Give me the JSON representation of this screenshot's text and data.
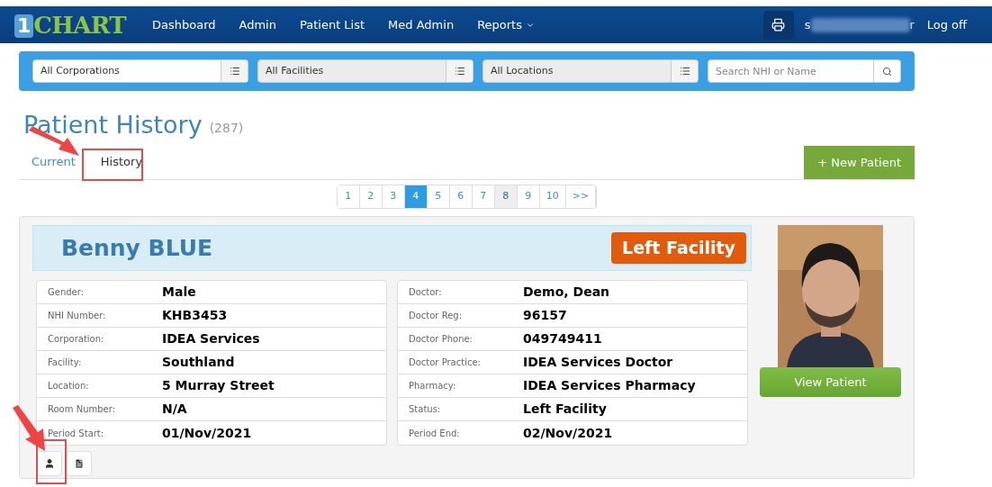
{
  "navbar": {
    "logo": {
      "digit": "1",
      "word": "CHART"
    },
    "menu": [
      {
        "label": "Dashboard",
        "kind": "link"
      },
      {
        "label": "Admin",
        "kind": "link"
      },
      {
        "label": "Patient List",
        "kind": "link"
      },
      {
        "label": "Med Admin",
        "kind": "link"
      },
      {
        "label": "Reports",
        "kind": "dropdown"
      }
    ],
    "user": {
      "first_letter": "s",
      "last_letter": "r"
    },
    "logoff": "Log off"
  },
  "filters": [
    {
      "value": "All Corporations",
      "disabled": false
    },
    {
      "value": "All Facilities",
      "disabled": true
    },
    {
      "value": "All Locations",
      "disabled": true
    }
  ],
  "search": {
    "placeholder": "Search NHI or Name"
  },
  "page": {
    "title": "Patient History",
    "count": "(287)"
  },
  "tabs": [
    {
      "label": "Current",
      "selected": false
    },
    {
      "label": "History",
      "selected": true
    }
  ],
  "new_patient_button": "+ New Patient",
  "pagination": [
    {
      "label": "1",
      "selected": false,
      "hovered": false
    },
    {
      "label": "2",
      "selected": false,
      "hovered": false
    },
    {
      "label": "3",
      "selected": false,
      "hovered": false
    },
    {
      "label": "4",
      "selected": true,
      "hovered": false
    },
    {
      "label": "5",
      "selected": false,
      "hovered": false
    },
    {
      "label": "6",
      "selected": false,
      "hovered": false
    },
    {
      "label": "7",
      "selected": false,
      "hovered": false
    },
    {
      "label": "8",
      "selected": false,
      "hovered": true
    },
    {
      "label": "9",
      "selected": false,
      "hovered": false
    },
    {
      "label": "10",
      "selected": false,
      "hovered": false
    },
    {
      "label": ">>",
      "selected": false,
      "hovered": false
    }
  ],
  "patient": {
    "name": "Benny BLUE",
    "status_badge": "Left Facility",
    "left_fields": [
      {
        "label": "Gender:",
        "value": "Male"
      },
      {
        "label": "NHI Number:",
        "value": "KHB3453"
      },
      {
        "label": "Corporation:",
        "value": "IDEA Services"
      },
      {
        "label": "Facility:",
        "value": "Southland"
      },
      {
        "label": "Location:",
        "value": "5 Murray Street"
      },
      {
        "label": "Room Number:",
        "value": "N/A"
      },
      {
        "label": "Period Start:",
        "value": "01/Nov/2021"
      }
    ],
    "right_fields": [
      {
        "label": "Doctor:",
        "value": "Demo, Dean"
      },
      {
        "label": "Doctor Reg:",
        "value": "96157"
      },
      {
        "label": "Doctor Phone:",
        "value": "049749411"
      },
      {
        "label": "Doctor Practice:",
        "value": "IDEA Services Doctor"
      },
      {
        "label": "Pharmacy:",
        "value": "IDEA Services Pharmacy"
      },
      {
        "label": "Status:",
        "value": "Left Facility"
      },
      {
        "label": "Period End:",
        "value": "02/Nov/2021"
      }
    ],
    "view_button": "View Patient",
    "actions": [
      {
        "kind": "person"
      },
      {
        "kind": "document"
      }
    ]
  }
}
